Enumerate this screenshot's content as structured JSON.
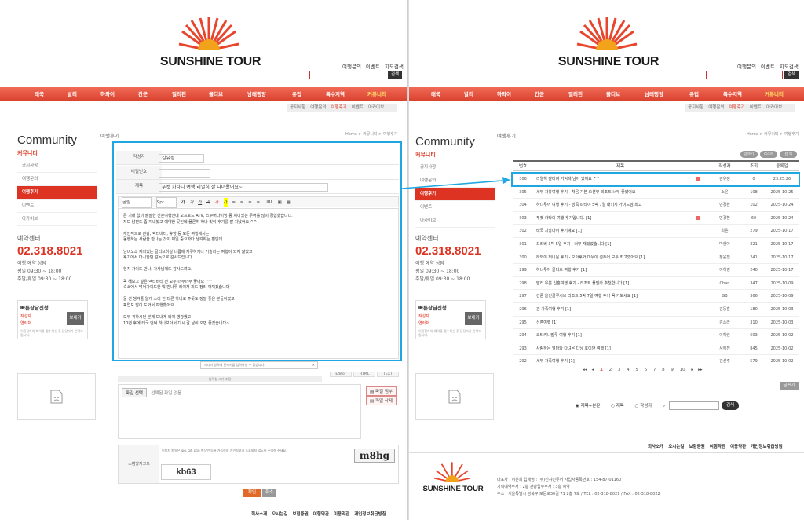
{
  "brand": {
    "name": "SUNSHINE TOUR"
  },
  "header": {
    "links": [
      "여행문의",
      "이벤트",
      "지도검색"
    ],
    "search_button": "검색",
    "gnb": [
      "태국",
      "발리",
      "하와이",
      "칸쿤",
      "필리핀",
      "몰디브",
      "남태평양",
      "유럽",
      "특수지역",
      "커뮤니티"
    ],
    "subnav": [
      "공지사항",
      "여행문의",
      "여행후기",
      "이벤트",
      "아카이브"
    ]
  },
  "sidebar": {
    "title": "Community",
    "subtitle": "커뮤니티",
    "menu": [
      "공지사항",
      "여행문의",
      "여행후기",
      "이벤트",
      "아카이브"
    ],
    "active_index": 2,
    "reservation_title": "예약센터",
    "phone": "02.318.8021",
    "hours": [
      "여행 예약 상담",
      "평일 09:30 ~ 18:00",
      "주말/휴일 09:30 ~ 18:00"
    ],
    "quick": {
      "title": "빠른상담신청",
      "name_label": "작성자",
      "phone_label": "연락처",
      "send_button": "보내기",
      "note": "이용절차와 예약을 접수하신 후 담당자가 연락드립니다."
    }
  },
  "left": {
    "page_title": "여행후기",
    "breadcrumb": "Home > 커뮤니티 > 여행후기",
    "form": {
      "author_label": "작성자",
      "author_value": "김유정",
      "password_label": "비밀번호",
      "subject_label": "제목",
      "subject_value": "푸켓 카타니 여행 리얼히 잘 다녀왔어요~"
    },
    "toolbar": [
      "굴림",
      "9pt",
      "가",
      "가",
      "가",
      "가",
      "가",
      "가",
      "≡",
      "≡",
      "≡",
      "≡",
      "URL"
    ],
    "editor_paragraphs": [
      "큰 기대 없이 출발한 신혼여행인데 오프로드 ATV, 스쿠버다이빙 등 처이있는 투어를 많이 경험했습니다.\n저도 남편도 좀 지내봤고 예약한 곳인데 물론히 하나 빛이 후기를 잘 지났어요 ^^",
      "개인적으로 관광, 액티비티, 휴양 등 모든 여행에서는\n동행하는 사람을 만나는 것이 제일 중요하다 생각하는 편인데",
      "남녀노소 재치있는 몰디브하실 나름에 지루하거나 거슬리는 여행이 되지 않았고\n후기에서 다시한번 감독으로 감사드립니다.",
      "현지 가이드 만나, 가사님께도 감사드려요.",
      "꼭 해보고 싶은 액티비티 전 모두 너무너무 좋아요 ^^\n숙소에서 먹어가이드한 빅 만나루 레이저 피드 정리 아끼겠습니다",
      "둘 썬 챙겨줄 알게 소리 안 다른 하나로 푸뜻도 정말 좋은 분들이었고\n픽업도 많이 도와서 여행했어요",
      "모두 귀하시던 분께 보내게 되어 영광했고\n10년 후에 태국 언덕 하나보아서 다시 갈 날이 오면 좋겠습니다~"
    ],
    "tip": "에디터 영역에 단축키를 입력하실 수 있습니다.",
    "editor_tabs": [
      "Editor",
      "HTML",
      "TEXT"
    ],
    "resize_label": "입력창 크기 조절",
    "file": {
      "button": "파일 선택",
      "status": "선택된 파일 없음",
      "attach": "파일 첨부",
      "delete": "파일 삭제"
    },
    "notice": "이미지 파일은 jpg, gif, png 형식만 등록 가능하며 개인정보가 노출되지 않도록 주의해 주세요.",
    "captcha": {
      "label": "스팸방지코드",
      "image_text": "m8hg",
      "input_value": "kb63"
    },
    "confirm_button": "확인",
    "cancel_button": "취소"
  },
  "right": {
    "page_title": "여행후기",
    "breadcrumb": "Home > 커뮤니티 > 여행후기",
    "pills": [
      "글쓰기",
      "리스트",
      "검 색"
    ],
    "columns": [
      "번호",
      "제목",
      "작성자",
      "조회",
      "등록일"
    ],
    "rows": [
      {
        "no": "306",
        "title": "리얼히 잘다녀 기억에 남아 있어요 ^^",
        "author": "김유정",
        "views": "0",
        "date": "23:25:26",
        "new": true
      },
      {
        "no": "305",
        "title": "세부 자유여행 후기 - 처음 가본 오션뷰 리조트 너무 좋았어요",
        "author": "소윤",
        "views": "108",
        "date": "2025-10-25",
        "new": false
      },
      {
        "no": "304",
        "title": "하나투어 여행 후기 - 방콕 파타야 5박 7일 패키지 가이드님 최고",
        "author": "민경환",
        "views": "102",
        "date": "2025-10-24",
        "new": false
      },
      {
        "no": "303",
        "title": "푸켓 카타의 여행 후기입니다. [1]",
        "author": "민경환",
        "views": "60",
        "date": "2025-10-24",
        "new": true
      },
      {
        "no": "302",
        "title": "태국 치앙마이 후기예요 [1]",
        "author": "최윤",
        "views": "279",
        "date": "2025-10-17",
        "new": false
      },
      {
        "no": "301",
        "title": "끄라비 3박 5일 후기 - 너무 재밌었습니다 [1]",
        "author": "박현아",
        "views": "221",
        "date": "2025-10-17",
        "new": false
      },
      {
        "no": "300",
        "title": "하와이 허니문 후기 - 오아후와 마우이 섬투어 모두 최고였어요 [1]",
        "author": "정윤진",
        "views": "241",
        "date": "2025-10-17",
        "new": false
      },
      {
        "no": "299",
        "title": "하나투어 몰디브 여행 후기 [1]",
        "author": "이하영",
        "views": "240",
        "date": "2025-10-17",
        "new": false
      },
      {
        "no": "298",
        "title": "발리 우붓 신혼여행 후기 - 리조트 풀빌라 추천합니다 [1]",
        "author": "Chan",
        "views": "347",
        "date": "2025-10-09",
        "new": false
      },
      {
        "no": "297",
        "title": "칸쿤 올인클루시브 리조트 5박 7일 여행 후기 꼭 가보세요 [1]",
        "author": "GB",
        "views": "366",
        "date": "2025-10-09",
        "new": false
      },
      {
        "no": "296",
        "title": "괌 가족여행 후기 [1]",
        "author": "김동훈",
        "views": "180",
        "date": "2025-10-03",
        "new": false
      },
      {
        "no": "295",
        "title": "신혼여행 [1]",
        "author": "김소라",
        "views": "310",
        "date": "2025-10-03",
        "new": false
      },
      {
        "no": "294",
        "title": "코타키나발루 여행 후기 [1]",
        "author": "이혜란",
        "views": "603",
        "date": "2025-10-02",
        "new": false
      },
      {
        "no": "293",
        "title": "사랑하는 엄마와 다녀온 다낭 호이안 여행 [1]",
        "author": "서혜진",
        "views": "845",
        "date": "2025-10-02",
        "new": false
      },
      {
        "no": "292",
        "title": "세부 가족여행 후기 [1]",
        "author": "김선주",
        "views": "579",
        "date": "2025-10-02",
        "new": false
      }
    ],
    "pages": [
      "1",
      "2",
      "3",
      "4",
      "5",
      "6",
      "7",
      "8",
      "9",
      "10"
    ],
    "current_page": "1",
    "write_button": "글쓰기",
    "search_options": [
      "제목+본문",
      "제목",
      "작성자"
    ],
    "search_button": "검색",
    "footer_address": [
      "대표자 : 이은희    업체명 : (주)선샤인투어    사업자등록번호 : 154-87-01160",
      "기획예약부서 : 2층 관광업무부서 : 3층 예약",
      "주소 : 서울특별시 성북구 보문로30길 71 2층 7호 / TEL : 02-318-8021 / FAX : 02-318-8022"
    ]
  },
  "footer": {
    "links": [
      "회사소개",
      "오시는길",
      "보험증권",
      "여행약관",
      "이용약관",
      "개인정보취급방침"
    ]
  },
  "colors": {
    "accent": "#d9412e",
    "highlight": "#1ea7e0"
  }
}
